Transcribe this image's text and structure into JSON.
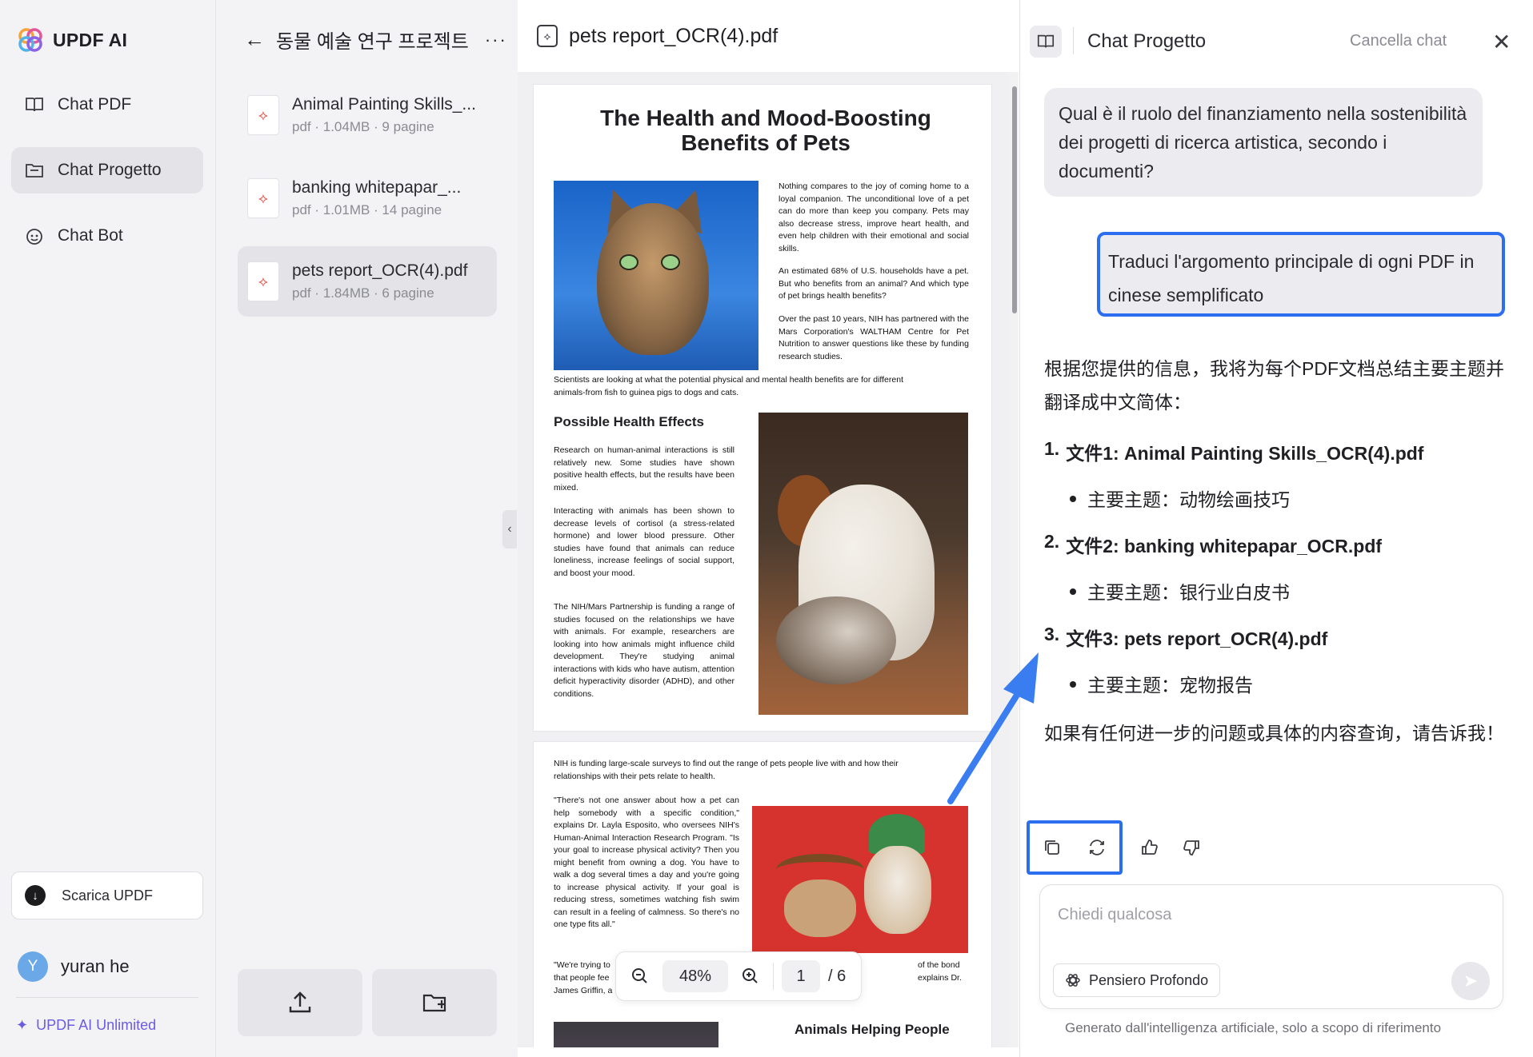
{
  "app": {
    "name": "UPDF AI"
  },
  "nav": {
    "items": [
      {
        "label": "Chat PDF",
        "icon": "book-icon"
      },
      {
        "label": "Chat Progetto",
        "icon": "folder-chat-icon"
      },
      {
        "label": "Chat Bot",
        "icon": "bot-icon"
      }
    ],
    "download_label": "Scarica UPDF",
    "user": {
      "initial": "Y",
      "name": "yuran he"
    },
    "plan": "UPDF AI Unlimited"
  },
  "project": {
    "title": "동물 예술 연구 프로젝트",
    "files": [
      {
        "name": "Animal Painting Skills_...",
        "meta": "pdf · 1.04MB · 9 pagine"
      },
      {
        "name": "banking whitepapar_...",
        "meta": "pdf · 1.01MB · 14 pagine"
      },
      {
        "name": "pets report_OCR(4).pdf",
        "meta": "pdf · 1.84MB · 6 pagine"
      }
    ]
  },
  "viewer": {
    "filename": "pets report_OCR(4).pdf",
    "zoom": "48%",
    "page": "1",
    "total_pages": "/ 6",
    "doc": {
      "title": "The Health and Mood-Boosting Benefits of Pets",
      "intro": "Nothing compares to the joy of coming home to a loyal companion. The unconditional love of a pet can do more than keep you company. Pets may also decrease stress, improve heart health, and even help children with their emotional and social skills.",
      "p2": "An estimated 68% of U.S. households have a pet. But who benefits from an animal? And which type of pet brings health benefits?",
      "p3": "Over the past 10 years, NIH has partnered with the Mars Corporation's WALTHAM Centre for Pet Nutrition to answer questions like these by funding research studies.",
      "caption": "Scientists are looking at what the potential physical and mental health benefits are for different animals-from fish to guinea pigs to dogs and cats.",
      "heading1": "Possible Health Effects",
      "h1p1": "Research on human-animal interactions is still relatively new. Some studies have shown positive health effects, but the results have been mixed.",
      "h1p2": "Interacting with animals has been shown to decrease levels of cortisol (a stress-related hormone) and lower blood pressure. Other studies have found that animals can reduce loneliness, increase feelings of social support, and boost your mood.",
      "h1p3": "The NIH/Mars Partnership is funding a range of studies focused on the relationships we have with animals. For example, researchers are looking into how animals might influence child development. They're studying animal interactions with kids who have autism, attention deficit hyperactivity disorder (ADHD), and other conditions.",
      "page2_intro": "NIH is funding large-scale surveys to find out the range of pets people live with and how their relationships with their pets relate to health.",
      "page2_quote": "\"There's not one answer about how a pet can help somebody with a specific condition,\" explains Dr. Layla Esposito, who oversees NIH's Human-Animal Interaction Research Program. \"Is your goal to increase physical activity? Then you might benefit from owning a dog. You have to walk a dog several times a day and you're going to increase physical activity. If your goal is reducing stress, sometimes watching fish swim can result in a feeling of calmness. So there's no one type fits all.\"",
      "page2_quote2_start": "\"We're trying to",
      "page2_quote2_line2": "that people fee",
      "page2_quote2_line3": "James Griffin, a",
      "page2_right1": "of the bond",
      "page2_right2": "explains Dr.",
      "heading2": "Animals Helping People"
    }
  },
  "chat": {
    "title": "Chat Progetto",
    "clear_label": "Cancella chat",
    "question_prev": "Qual è il ruolo del finanziamento nella sostenibilità dei progetti di ricerca artistica, secondo i documenti?",
    "user_message": "Traduci l'argomento principale di ogni PDF in cinese semplificato",
    "answer": {
      "intro": "根据您提供的信息，我将为每个PDF文档总结主要主题并翻译成中文简体：",
      "items": [
        {
          "num": "1.",
          "title": "文件1: Animal Painting Skills_OCR(4).pdf",
          "sub": "主要主题：动物绘画技巧"
        },
        {
          "num": "2.",
          "title": "文件2: banking whitepapar_OCR.pdf",
          "sub": "主要主题：银行业白皮书"
        },
        {
          "num": "3.",
          "title": "文件3: pets report_OCR(4).pdf",
          "sub": "主要主题：宠物报告"
        }
      ],
      "outro": "如果有任何进一步的问题或具体的内容查询，请告诉我！"
    },
    "input_placeholder": "Chiedi qualcosa",
    "deep_label": "Pensiero Profondo",
    "disclaimer": "Generato dall'intelligenza artificiale, solo a scopo di riferimento"
  },
  "colors": {
    "accent": "#2c6ef0",
    "plan": "#6b5ce0",
    "pdf": "#e0574f"
  }
}
